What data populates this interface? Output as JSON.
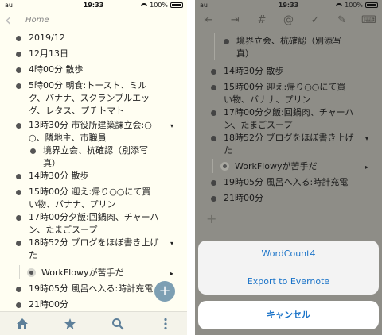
{
  "status": {
    "carrier": "au",
    "time": "19:33",
    "battery": "100%"
  },
  "left": {
    "breadcrumb": "Home",
    "items": [
      {
        "lines": [
          "2019/12"
        ]
      },
      {
        "lines": [
          "12月13日"
        ]
      },
      {
        "lines": [
          "4時00分 散歩"
        ]
      },
      {
        "lines": [
          "5時00分 朝食:トースト、ミル",
          "ク、バナナ、スクランブルエッ",
          "グ、レタス、プチトマト"
        ]
      },
      {
        "lines": [
          "13時30分 市役所建築課立会:○",
          "○、隣地主、市職員"
        ]
      },
      {
        "lines": [
          "境界立会、杭確認（別添写",
          "真）"
        ]
      },
      {
        "lines": [
          "14時30分 散歩"
        ]
      },
      {
        "lines": [
          "15時00分 迎え:帰り○○にて買",
          "い物、バナナ、プリン"
        ]
      },
      {
        "lines": [
          "17時00分夕飯:回鍋肉、チャーハ",
          "ン、たまごスープ"
        ]
      },
      {
        "lines": [
          "18時52分 ブログをほぼ書き上げ",
          "た"
        ]
      },
      {
        "lines": [
          "WorkFlowyが苦手だ"
        ]
      },
      {
        "lines": [
          "19時05分 風呂へ入る:時計充電"
        ]
      },
      {
        "lines": [
          "21時00分"
        ]
      }
    ],
    "fab": "+"
  },
  "tabs": {
    "home": "home-icon",
    "star": "star-icon",
    "search": "search-icon",
    "more": "more-icon"
  },
  "right": {
    "toolbar": [
      "⇤",
      "⇥",
      "#",
      "@",
      "✓",
      "✎",
      "⌨"
    ],
    "items": [
      {
        "lines": [
          "境界立会、杭確認（別添写",
          "真）"
        ]
      },
      {
        "lines": [
          "14時30分 散歩"
        ]
      },
      {
        "lines": [
          "15時00分 迎え:帰り○○にて買",
          "い物、バナナ、プリン"
        ]
      },
      {
        "lines": [
          "17時00分夕飯:回鍋肉、チャーハ",
          "ン、たまごスープ"
        ]
      },
      {
        "lines": [
          "18時52分 ブログをほぼ書き上げ",
          "た"
        ]
      },
      {
        "lines": [
          "WorkFlowyが苦手だ"
        ]
      },
      {
        "lines": [
          "19時05分 風呂へ入る:時計充電"
        ]
      },
      {
        "lines": [
          "21時00分"
        ]
      }
    ],
    "plus": "+",
    "sheet": {
      "option1": "WordCount4",
      "option2": "Export to Evernote",
      "cancel": "キャンセル"
    }
  },
  "colors": {
    "accent": "#1a73c8",
    "fab": "#7d9fb3",
    "background": "#fffef2",
    "overlay": "#8e8d87"
  }
}
